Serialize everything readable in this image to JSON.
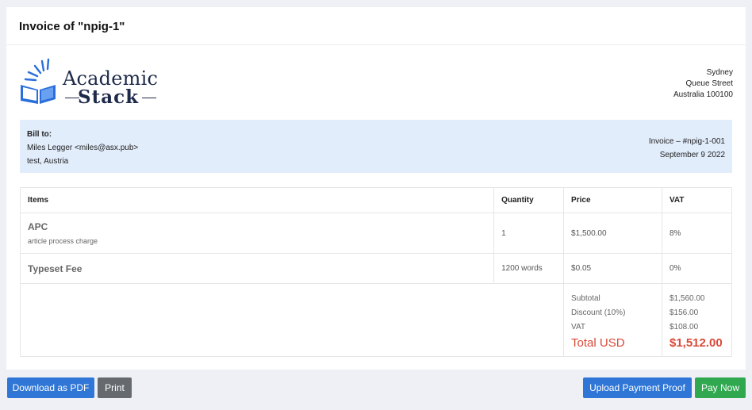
{
  "header": {
    "title": "Invoice of \"npig-1\""
  },
  "logo": {
    "line1": "Academic",
    "line2": "Stack",
    "accent_color": "#2a6fdb"
  },
  "company_address": {
    "line1": "Sydney",
    "line2": "Queue Street",
    "line3": "Australia 100100"
  },
  "bill_to": {
    "label": "Bill to:",
    "name": "Miles Legger <miles@asx.pub>",
    "location": "test, Austria"
  },
  "invoice": {
    "number": "Invoice – #npig-1-001",
    "date": "September 9 2022"
  },
  "table": {
    "headers": {
      "items": "Items",
      "quantity": "Quantity",
      "price": "Price",
      "vat": "VAT"
    },
    "rows": [
      {
        "name": "APC",
        "description": "article process charge",
        "quantity": "1",
        "price": "$1,500.00",
        "vat": "8%"
      },
      {
        "name": "Typeset Fee",
        "description": "",
        "quantity": "1200 words",
        "price": "$0.05",
        "vat": "0%"
      }
    ]
  },
  "totals": {
    "subtotal_label": "Subtotal",
    "subtotal_value": "$1,560.00",
    "discount_label": "Discount (10%)",
    "discount_value": "$156.00",
    "vat_label": "VAT",
    "vat_value": "$108.00",
    "total_label": "Total USD",
    "total_value": "$1,512.00",
    "total_color": "#d94a3a"
  },
  "actions": {
    "download_pdf": "Download as PDF",
    "print": "Print",
    "upload_proof": "Upload Payment Proof",
    "pay_now": "Pay Now"
  }
}
